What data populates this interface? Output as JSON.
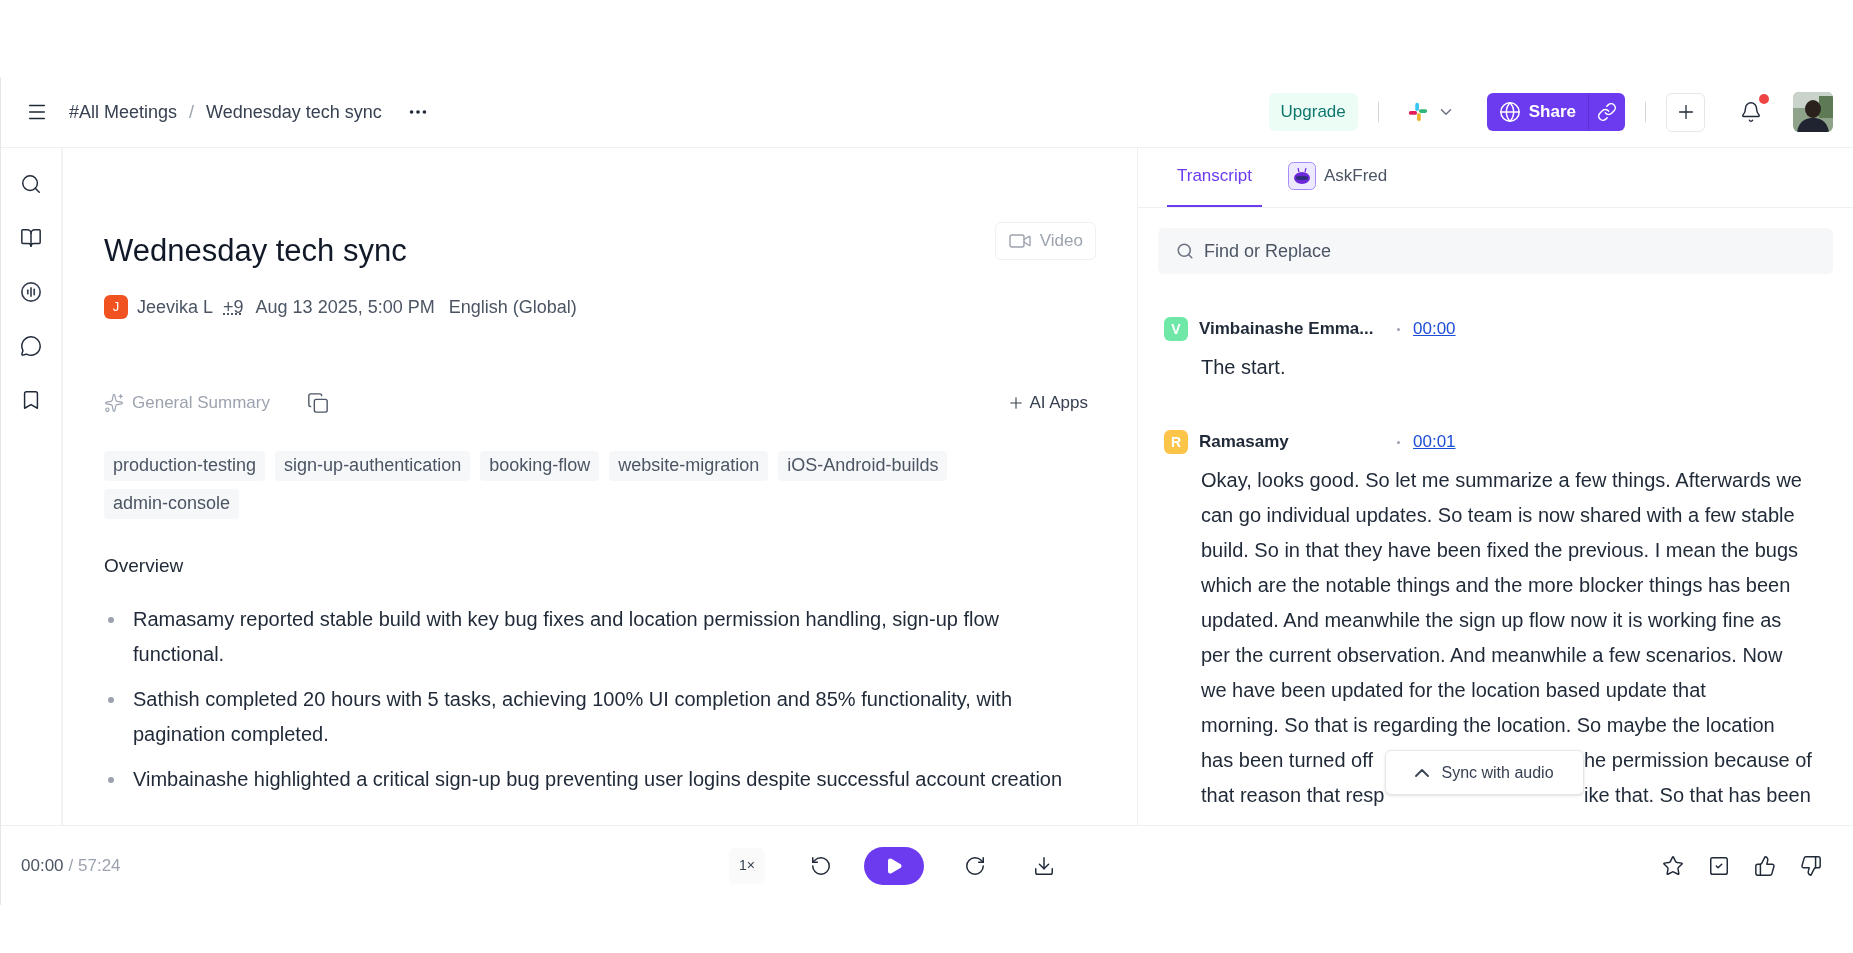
{
  "header": {
    "breadcrumb": [
      "#All Meetings",
      "Wednesday tech sync"
    ],
    "breadcrumb_separator": "/",
    "upgrade_button": "Upgrade",
    "share_button": "Share",
    "notifications": {
      "unread": true
    }
  },
  "meeting": {
    "title": "Wednesday tech sync",
    "video_button": {
      "label": "Video",
      "disabled": true
    },
    "host": {
      "initial": "J",
      "name": "Jeevika L",
      "color": "#f0531f"
    },
    "extra_participants": "+9",
    "datetime": "Aug 13 2025, 5:00 PM",
    "language": "English (Global)"
  },
  "summary": {
    "label": "General Summary",
    "ai_apps": "AI Apps",
    "tags": [
      "production-testing",
      "sign-up-authentication",
      "booking-flow",
      "website-migration",
      "iOS-Android-builds",
      "admin-console"
    ],
    "section_title": "Overview",
    "bullets": [
      "Ramasamy reported stable build with key bug fixes and location permission handling, sign-up flow functional.",
      "Sathish completed 20 hours with 5 tasks, achieving 100% UI completion and 85% functionality, with pagination completed.",
      "Vimbainashe highlighted a critical sign-up bug preventing user logins despite successful account creation"
    ]
  },
  "transcript_panel": {
    "tabs": [
      {
        "label": "Transcript",
        "selected": true,
        "kind": "text"
      },
      {
        "label": "AskFred",
        "selected": false,
        "kind": "bot"
      }
    ],
    "search": {
      "placeholder": "Find or Replace"
    },
    "entries": [
      {
        "initial": "V",
        "speaker": "Vimbainashe Emma...",
        "color": "#6ee7a7",
        "time": "00:00",
        "lines": [
          "The start."
        ]
      },
      {
        "initial": "R",
        "speaker": "Ramasamy",
        "color": "#fcc54a",
        "time": "00:01",
        "lines": [
          "Okay, looks good. So let me summarize a few things. Afterwards we",
          "can go individual updates. So team is now shared with a few stable",
          "build. So in that they have been fixed the previous. I mean the bugs",
          "which are the notable things and the more blocker things has been",
          "updated. And meanwhile the sign up flow now it is working fine as",
          "per the current observation. And meanwhile a few scenarios. Now",
          "we have been updated for the location based update that",
          "morning. So that is regarding the location. So maybe the location"
        ],
        "occluded_lines": [
          {
            "left": "has been turned off",
            "right": "he permission because of"
          },
          {
            "left": "that reason that resp",
            "right": "ike that. So that has been"
          }
        ]
      }
    ],
    "sync_button": "Sync with audio"
  },
  "player": {
    "current": "00:00",
    "duration": "/ 57:24",
    "speed": "1×"
  }
}
